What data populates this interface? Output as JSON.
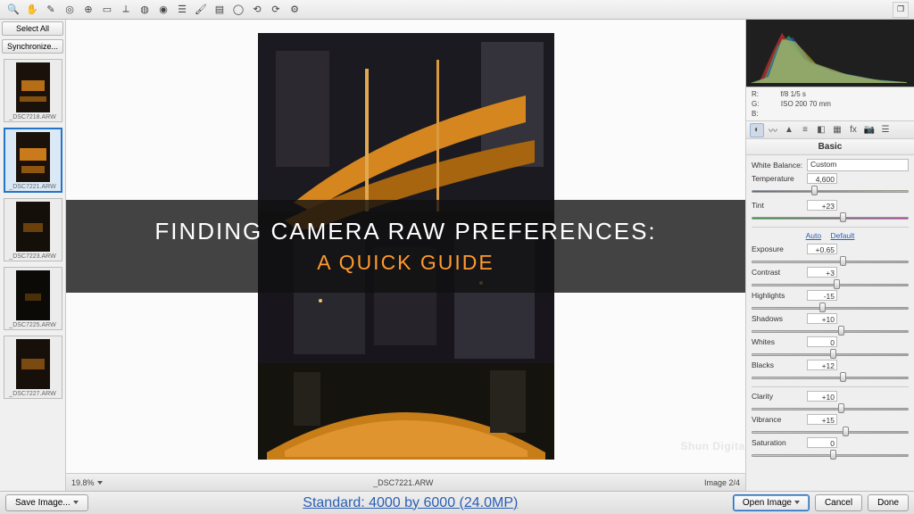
{
  "toolbar": {
    "icons": [
      "zoom",
      "hand",
      "eyedropper-icon",
      "sampler-icon",
      "target-icon",
      "crop-icon",
      "straighten-icon",
      "spot-icon",
      "redeye-icon",
      "adjust-icon",
      "brush-icon",
      "grad-icon",
      "radial-icon",
      "rotate-l-icon",
      "rotate-r-icon",
      "prefs-icon"
    ]
  },
  "filmstrip": {
    "select_all": "Select All",
    "sync": "Synchronize...",
    "items": [
      {
        "label": "_DSC7218.ARW"
      },
      {
        "label": "_DSC7221.ARW",
        "selected": true
      },
      {
        "label": "_DSC7223.ARW"
      },
      {
        "label": "_DSC7225.ARW"
      },
      {
        "label": "_DSC7227.ARW"
      }
    ]
  },
  "status": {
    "zoom": "19.8%",
    "filename": "_DSC7221.ARW",
    "page": "Image 2/4",
    "meta_link": "Standard: 4000 by 6000 (24.0MP)"
  },
  "footer": {
    "save": "Save Image...",
    "open": "Open Image",
    "cancel": "Cancel",
    "done": "Done"
  },
  "meta": {
    "r": "R:",
    "g": "G:",
    "b": "B:",
    "fstop": "f/8  1/5 s",
    "iso": "ISO 200   70 mm"
  },
  "panel": {
    "title": "Basic",
    "wb_label": "White Balance:",
    "wb_value": "Custom",
    "temp_label": "Temperature",
    "temp_value": "4,600",
    "tint_label": "Tint",
    "tint_value": "+23",
    "auto": "Auto",
    "default": "Default",
    "rows": [
      {
        "label": "Exposure",
        "value": "+0.65",
        "pos": 56
      },
      {
        "label": "Contrast",
        "value": "+3",
        "pos": 52
      },
      {
        "label": "Highlights",
        "value": "-15",
        "pos": 43
      },
      {
        "label": "Shadows",
        "value": "+10",
        "pos": 55
      },
      {
        "label": "Whites",
        "value": "0",
        "pos": 50
      },
      {
        "label": "Blacks",
        "value": "+12",
        "pos": 56
      }
    ],
    "rows2": [
      {
        "label": "Clarity",
        "value": "+10",
        "pos": 55
      },
      {
        "label": "Vibrance",
        "value": "+15",
        "pos": 58
      },
      {
        "label": "Saturation",
        "value": "0",
        "pos": 50
      }
    ]
  },
  "overlay": {
    "title": "FINDING CAMERA RAW PREFERENCES:",
    "sub": "A QUICK GUIDE",
    "brand": "Shun Digital"
  }
}
